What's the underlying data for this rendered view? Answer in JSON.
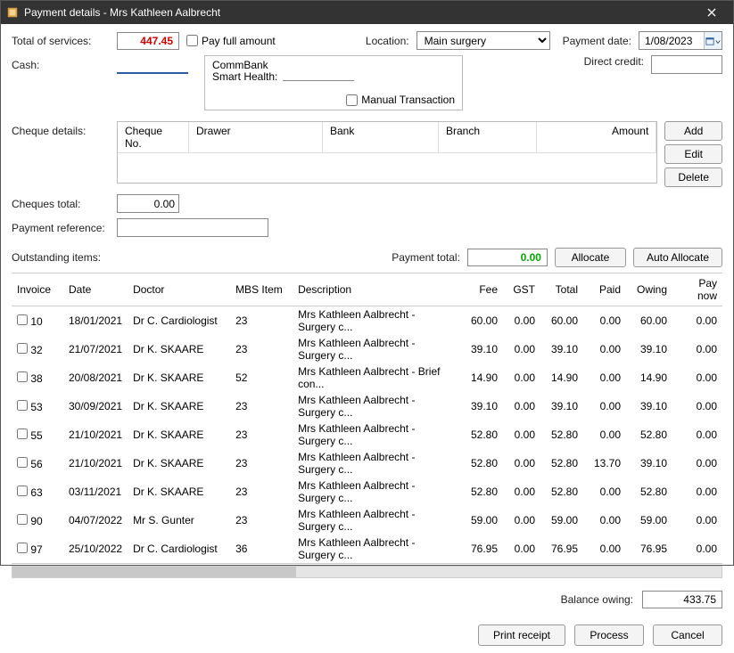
{
  "window": {
    "title": "Payment details - Mrs Kathleen Aalbrecht"
  },
  "labels": {
    "total_of_services": "Total of services:",
    "pay_full": "Pay full amount",
    "location": "Location:",
    "payment_date": "Payment date:",
    "cash": "Cash:",
    "commbank": "CommBank",
    "smart_health": "Smart Health:",
    "manual_txn": "Manual Transaction",
    "direct_credit": "Direct credit:",
    "cheque_details": "Cheque details:",
    "cheques_total": "Cheques total:",
    "payment_reference": "Payment reference:",
    "outstanding_items": "Outstanding items:",
    "payment_total": "Payment total:",
    "balance_owing": "Balance owing:"
  },
  "values": {
    "total_of_services": "447.45",
    "location_selected": "Main surgery",
    "payment_date": "1/08/2023",
    "cash": "",
    "smart_health": "",
    "direct_credit": "",
    "cheques_total": "0.00",
    "payment_reference": "",
    "payment_total": "0.00",
    "balance_owing": "433.75"
  },
  "buttons": {
    "add": "Add",
    "edit": "Edit",
    "delete": "Delete",
    "allocate": "Allocate",
    "auto_allocate": "Auto Allocate",
    "print_receipt": "Print receipt",
    "process": "Process",
    "cancel": "Cancel"
  },
  "cheque_columns": [
    "Cheque No.",
    "Drawer",
    "Bank",
    "Branch",
    "Amount"
  ],
  "grid_columns": [
    "Invoice",
    "Date",
    "Doctor",
    "MBS Item",
    "Description",
    "Fee",
    "GST",
    "Total",
    "Paid",
    "Owing",
    "Pay now"
  ],
  "grid_rows": [
    {
      "invoice": "10",
      "date": "18/01/2021",
      "doctor": "Dr C. Cardiologist",
      "mbs": "23",
      "desc": "Mrs Kathleen Aalbrecht - Surgery c...",
      "fee": "60.00",
      "gst": "0.00",
      "total": "60.00",
      "paid": "0.00",
      "owing": "60.00",
      "paynow": "0.00"
    },
    {
      "invoice": "32",
      "date": "21/07/2021",
      "doctor": "Dr K. SKAARE",
      "mbs": "23",
      "desc": "Mrs Kathleen Aalbrecht - Surgery c...",
      "fee": "39.10",
      "gst": "0.00",
      "total": "39.10",
      "paid": "0.00",
      "owing": "39.10",
      "paynow": "0.00"
    },
    {
      "invoice": "38",
      "date": "20/08/2021",
      "doctor": "Dr K. SKAARE",
      "mbs": "52",
      "desc": "Mrs Kathleen Aalbrecht - Brief con...",
      "fee": "14.90",
      "gst": "0.00",
      "total": "14.90",
      "paid": "0.00",
      "owing": "14.90",
      "paynow": "0.00"
    },
    {
      "invoice": "53",
      "date": "30/09/2021",
      "doctor": "Dr K. SKAARE",
      "mbs": "23",
      "desc": "Mrs Kathleen Aalbrecht - Surgery c...",
      "fee": "39.10",
      "gst": "0.00",
      "total": "39.10",
      "paid": "0.00",
      "owing": "39.10",
      "paynow": "0.00"
    },
    {
      "invoice": "55",
      "date": "21/10/2021",
      "doctor": "Dr K. SKAARE",
      "mbs": "23",
      "desc": "Mrs Kathleen Aalbrecht - Surgery c...",
      "fee": "52.80",
      "gst": "0.00",
      "total": "52.80",
      "paid": "0.00",
      "owing": "52.80",
      "paynow": "0.00"
    },
    {
      "invoice": "56",
      "date": "21/10/2021",
      "doctor": "Dr K. SKAARE",
      "mbs": "23",
      "desc": "Mrs Kathleen Aalbrecht - Surgery c...",
      "fee": "52.80",
      "gst": "0.00",
      "total": "52.80",
      "paid": "13.70",
      "owing": "39.10",
      "paynow": "0.00"
    },
    {
      "invoice": "63",
      "date": "03/11/2021",
      "doctor": "Dr K. SKAARE",
      "mbs": "23",
      "desc": "Mrs Kathleen Aalbrecht - Surgery c...",
      "fee": "52.80",
      "gst": "0.00",
      "total": "52.80",
      "paid": "0.00",
      "owing": "52.80",
      "paynow": "0.00"
    },
    {
      "invoice": "90",
      "date": "04/07/2022",
      "doctor": "Mr S. Gunter",
      "mbs": "23",
      "desc": "Mrs Kathleen Aalbrecht - Surgery c...",
      "fee": "59.00",
      "gst": "0.00",
      "total": "59.00",
      "paid": "0.00",
      "owing": "59.00",
      "paynow": "0.00"
    },
    {
      "invoice": "97",
      "date": "25/10/2022",
      "doctor": "Dr C. Cardiologist",
      "mbs": "36",
      "desc": "Mrs Kathleen Aalbrecht - Surgery c...",
      "fee": "76.95",
      "gst": "0.00",
      "total": "76.95",
      "paid": "0.00",
      "owing": "76.95",
      "paynow": "0.00"
    }
  ]
}
